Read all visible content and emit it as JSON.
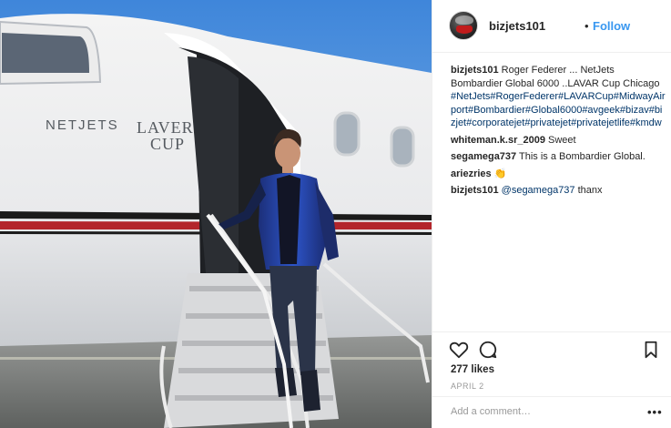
{
  "profile": {
    "username": "bizjets101",
    "separator": "•",
    "follow_label": "Follow"
  },
  "caption": {
    "user": "bizjets101",
    "text": "Roger Federer ... NetJets Bombardier Global 6000 ..LAVAR Cup Chicago",
    "hashtags": "#NetJets#RogerFederer#LAVARCup#MidwayAirport#Bombardier#Global6000#avgeek#bizav#bizjet#corporatejet#privatejet#privatejetlife#kmdw"
  },
  "comments": [
    {
      "user": "whiteman.k.sr_2009",
      "text": "Sweet"
    },
    {
      "user": "segamega737",
      "text": "This is a Bombardier Global."
    },
    {
      "user": "ariezries",
      "text": "👏"
    },
    {
      "user": "bizjets101",
      "mention": "@segamega737",
      "text": "thanx"
    }
  ],
  "actions": {
    "like_icon": "heart-icon",
    "comment_icon": "comment-bubble-icon",
    "save_icon": "bookmark-icon",
    "likes": "277 likes",
    "date": "APRIL 2",
    "comment_placeholder": "Add a comment…",
    "more_label": "•••"
  },
  "photo": {
    "brand_left": "NETJETS",
    "brand_right_top": "LAVER",
    "brand_right_bottom": "CUP"
  },
  "colors": {
    "link": "#003569",
    "follow": "#3897f0",
    "muted": "#999999"
  }
}
